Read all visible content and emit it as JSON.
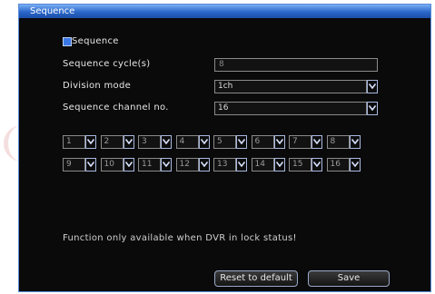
{
  "window": {
    "title": "Sequence"
  },
  "sequence_checkbox": {
    "label": "Sequence",
    "checked": true
  },
  "fields": {
    "cycle": {
      "label": "Sequence cycle(s)",
      "value": "8"
    },
    "division": {
      "label": "Division mode",
      "value": "1ch"
    },
    "channel_no": {
      "label": "Sequence channel no.",
      "value": "16"
    }
  },
  "channels_row1": [
    "1",
    "2",
    "3",
    "4",
    "5",
    "6",
    "7",
    "8"
  ],
  "channels_row2": [
    "9",
    "10",
    "11",
    "12",
    "13",
    "14",
    "15",
    "16"
  ],
  "notice": "Function only available when DVR in lock status!",
  "buttons": {
    "reset": "Reset to default",
    "save": "Save"
  },
  "colors": {
    "accent": "#2a66c8",
    "background": "#0a0a0a"
  }
}
